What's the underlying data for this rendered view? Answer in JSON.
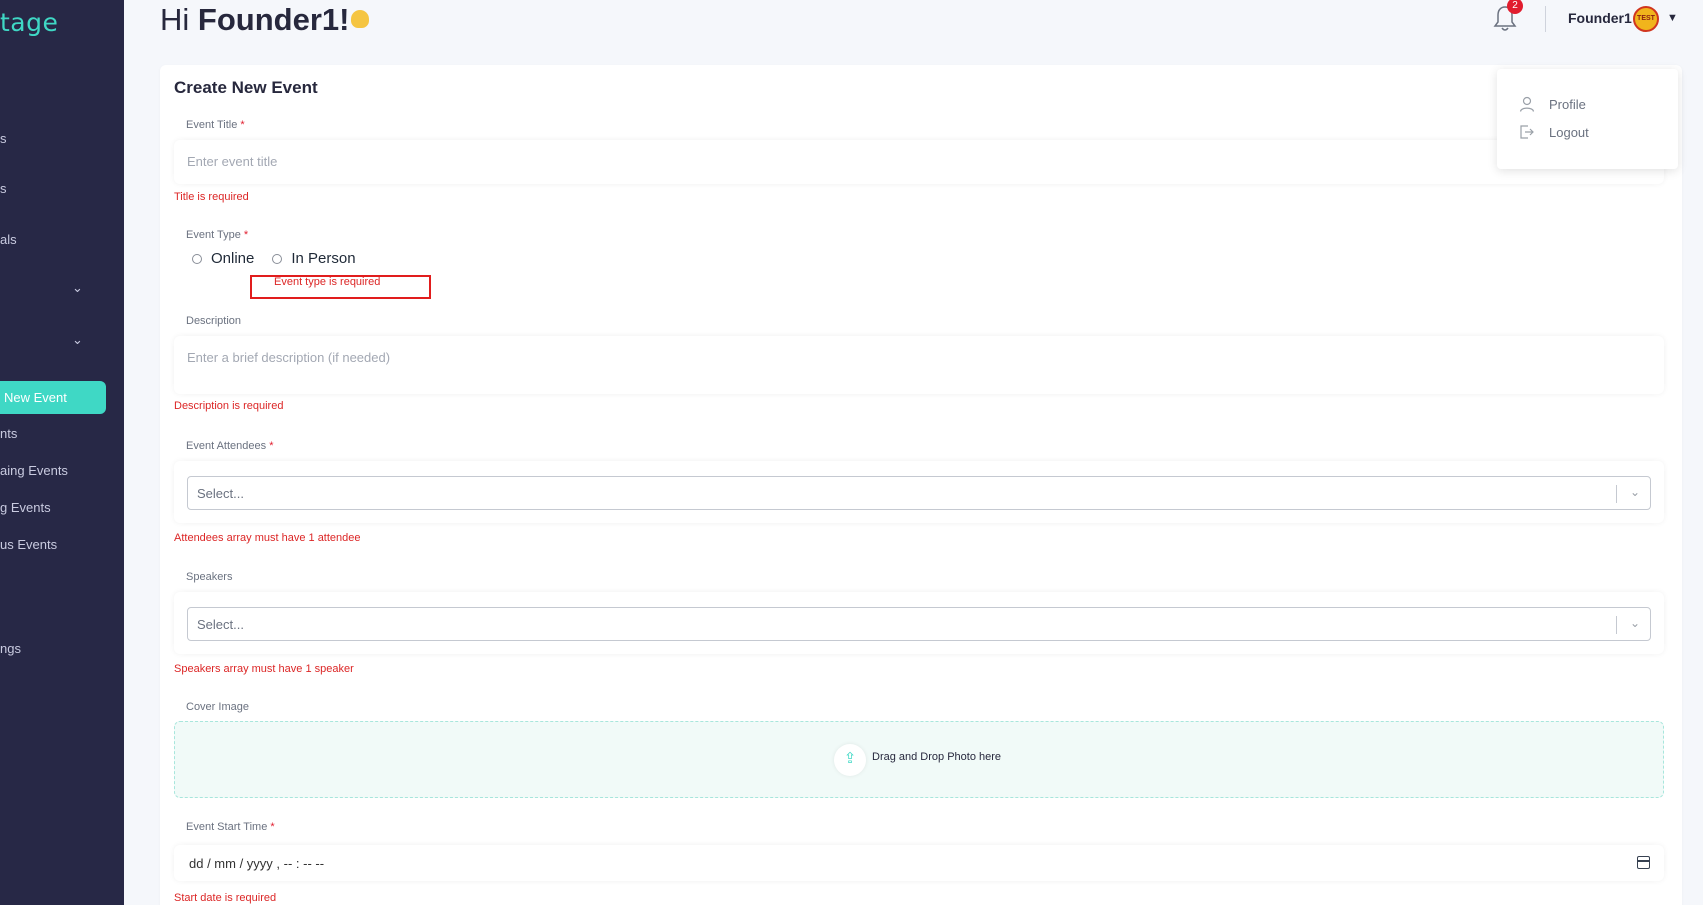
{
  "sidebar": {
    "logo": "tage",
    "items": [
      {
        "label": "s"
      },
      {
        "label": "s"
      },
      {
        "label": "als"
      },
      {
        "label": ""
      },
      {
        "label": ""
      },
      {
        "label": "New Event"
      },
      {
        "label": "nts"
      },
      {
        "label": "aing Events"
      },
      {
        "label": "g Events"
      },
      {
        "label": "us Events"
      },
      {
        "label": "ngs"
      }
    ],
    "chevron": "⌄"
  },
  "header": {
    "greeting": "Hi",
    "name": "Founder1!",
    "notification_count": "2",
    "user_name": "Founder1",
    "avatar_text": "TEST"
  },
  "user_menu": {
    "items": [
      {
        "label": "Profile",
        "icon": "user-icon"
      },
      {
        "label": "Logout",
        "icon": "logout-icon"
      }
    ]
  },
  "form": {
    "title": "Create New Event",
    "event_title": {
      "label": "Event Title",
      "required": "*",
      "placeholder": "Enter event title",
      "error": "Title is required"
    },
    "event_type": {
      "label": "Event Type",
      "required": "*",
      "options": [
        "Online",
        "In Person"
      ],
      "error": "Event type is required"
    },
    "description": {
      "label": "Description",
      "placeholder": "Enter a brief description (if needed)",
      "error": "Description is required"
    },
    "attendees": {
      "label": "Event Attendees",
      "required": "*",
      "placeholder": "Select...",
      "error": "Attendees array must have 1 attendee"
    },
    "speakers": {
      "label": "Speakers",
      "placeholder": "Select...",
      "error": "Speakers array must have 1 speaker"
    },
    "cover_image": {
      "label": "Cover Image",
      "dropzone_text": "Drag and Drop Photo here"
    },
    "start_time": {
      "label": "Event Start Time",
      "required": "*",
      "value": "dd / mm / yyyy ,  -- : --   --",
      "error": "Start date is required"
    }
  },
  "colors": {
    "sidebar_bg": "#272846",
    "accent": "#3fd8c5",
    "error": "#dc2626",
    "highlight": "#e11d1d"
  }
}
